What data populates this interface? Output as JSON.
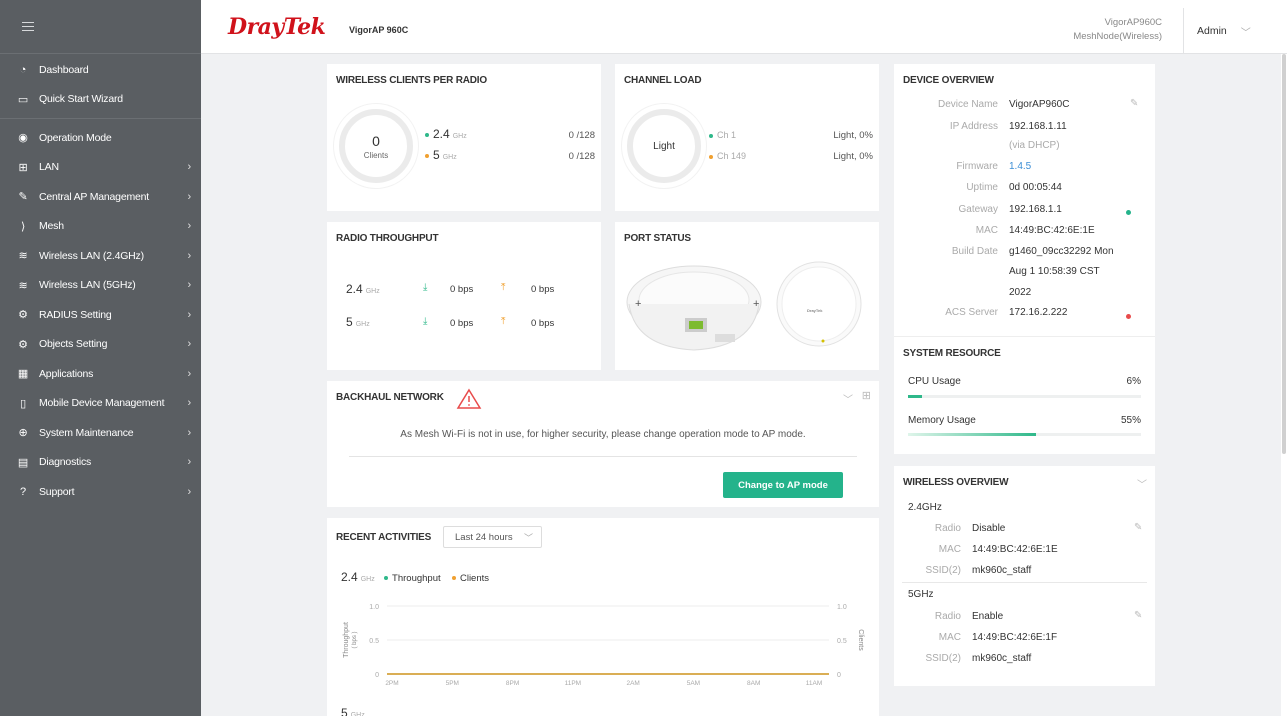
{
  "sidebar": {
    "items": [
      {
        "label": "Dashboard",
        "icon": "dashboard-icon",
        "chev": false
      },
      {
        "label": "Quick Start Wizard",
        "icon": "wizard-icon",
        "chev": false
      },
      {
        "label": "Operation Mode",
        "icon": "operation-mode-icon",
        "chev": false
      },
      {
        "label": "LAN",
        "icon": "lan-icon",
        "chev": true
      },
      {
        "label": "Central AP Management",
        "icon": "central-ap-icon",
        "chev": true
      },
      {
        "label": "Mesh",
        "icon": "mesh-icon",
        "chev": true
      },
      {
        "label": "Wireless LAN (2.4GHz)",
        "icon": "wifi-icon",
        "chev": true
      },
      {
        "label": "Wireless LAN (5GHz)",
        "icon": "wifi-icon",
        "chev": true
      },
      {
        "label": "RADIUS Setting",
        "icon": "gear-icon",
        "chev": true
      },
      {
        "label": "Objects Setting",
        "icon": "gear-icon",
        "chev": true
      },
      {
        "label": "Applications",
        "icon": "applications-icon",
        "chev": true
      },
      {
        "label": "Mobile Device Management",
        "icon": "mobile-icon",
        "chev": true
      },
      {
        "label": "System Maintenance",
        "icon": "maintenance-icon",
        "chev": true
      },
      {
        "label": "Diagnostics",
        "icon": "diagnostics-icon",
        "chev": true
      },
      {
        "label": "Support",
        "icon": "support-icon",
        "chev": true
      }
    ],
    "chevron": "›"
  },
  "header": {
    "logo_a": "Dray",
    "logo_b": "Tek",
    "model": "VigorAP 960C",
    "device_name": "VigorAP960C",
    "device_role": "MeshNode(Wireless)",
    "user": "Admin",
    "user_chev": "﹀"
  },
  "clients": {
    "title": "WIRELESS CLIENTS PER RADIO",
    "count": "0",
    "count_label": "Clients",
    "r24": "2.4",
    "r5": "5",
    "unit": "GHz",
    "r24_val": "0 /128",
    "r5_val": "0 /128"
  },
  "channel": {
    "title": "CHANNEL LOAD",
    "center": "Light",
    "ch1": "Ch 1",
    "ch2": "Ch 149",
    "ch1_val": "Light, 0%",
    "ch2_val": "Light, 0%"
  },
  "device": {
    "title": "DEVICE OVERVIEW",
    "name_k": "Device Name",
    "name_v": "VigorAP960C",
    "ip_k": "IP Address",
    "ip_v": "192.168.1.11",
    "ip_sub": "(via DHCP)",
    "fw_k": "Firmware",
    "fw_v": "1.4.5",
    "up_k": "Uptime",
    "up_v": "0d 00:05:44",
    "gw_k": "Gateway",
    "gw_v": "192.168.1.1",
    "mac_k": "MAC",
    "mac_v": "14:49:BC:42:6E:1E",
    "bd_k": "Build Date",
    "bd_v1": "g1460_09cc32292 Mon",
    "bd_v2": "Aug 1 10:58:39 CST",
    "bd_v3": "2022",
    "acs_k": "ACS Server",
    "acs_v": "172.16.2.222"
  },
  "throughput": {
    "title": "RADIO THROUGHPUT",
    "r24": "2.4",
    "r5": "5",
    "unit": "GHz",
    "r24_down": "0 bps",
    "r24_up": "0 bps",
    "r5_down": "0 bps",
    "r5_up": "0 bps"
  },
  "port": {
    "title": "PORT STATUS",
    "brand": "DrayTek"
  },
  "resource": {
    "title": "SYSTEM RESOURCE",
    "cpu_label": "CPU Usage",
    "cpu_val": "6%",
    "cpu_frac": 0.06,
    "mem_label": "Memory Usage",
    "mem_val": "55%",
    "mem_frac": 0.55
  },
  "backhaul": {
    "title": "BACKHAUL NETWORK",
    "message": "As Mesh Wi-Fi is not in use, for higher security, please change operation mode to AP mode.",
    "button": "Change to AP mode"
  },
  "wireless": {
    "title": "WIRELESS OVERVIEW",
    "b24": "2.4GHz",
    "b24_radio_k": "Radio",
    "b24_radio_v": "Disable",
    "b24_mac_k": "MAC",
    "b24_mac_v": "14:49:BC:42:6E:1E",
    "b24_ssid_k": "SSID(2)",
    "b24_ssid_v": "mk960c_staff",
    "b5": "5GHz",
    "b5_radio_k": "Radio",
    "b5_radio_v": "Enable",
    "b5_mac_k": "MAC",
    "b5_mac_v": "14:49:BC:42:6E:1F",
    "b5_ssid_k": "SSID(2)",
    "b5_ssid_v": "mk960c_staff"
  },
  "activities": {
    "title": "RECENT ACTIVITIES",
    "range": "Last 24 hours",
    "band": "2.4",
    "unit": "GHz",
    "legend_tp": "Throughput",
    "legend_cl": "Clients",
    "ylabel_l": "Throughput",
    "ylabel_l2": "( bps )",
    "ylabel_r": "Clients",
    "band2": "5"
  },
  "chart_data": {
    "type": "line",
    "categories": [
      "2PM",
      "5PM",
      "8PM",
      "11PM",
      "2AM",
      "5AM",
      "8AM",
      "11AM"
    ],
    "series": [
      {
        "name": "Throughput",
        "values": [
          0,
          0,
          0,
          0,
          0,
          0,
          0,
          0
        ]
      },
      {
        "name": "Clients",
        "values": [
          0,
          0,
          0,
          0,
          0,
          0,
          0,
          0
        ]
      }
    ],
    "yticks": [
      "1.0",
      "0.5",
      "0"
    ],
    "ylim": [
      0,
      1.0
    ],
    "xlabel": "",
    "ylabel": "Throughput ( bps )",
    "y2label": "Clients",
    "colors": {
      "throughput": "#2eb88a",
      "clients": "#f0a030"
    }
  },
  "colors": {
    "green": "#24b38b",
    "orange": "#f0a030",
    "red": "#e84b4b",
    "link": "#3d8fd6"
  }
}
